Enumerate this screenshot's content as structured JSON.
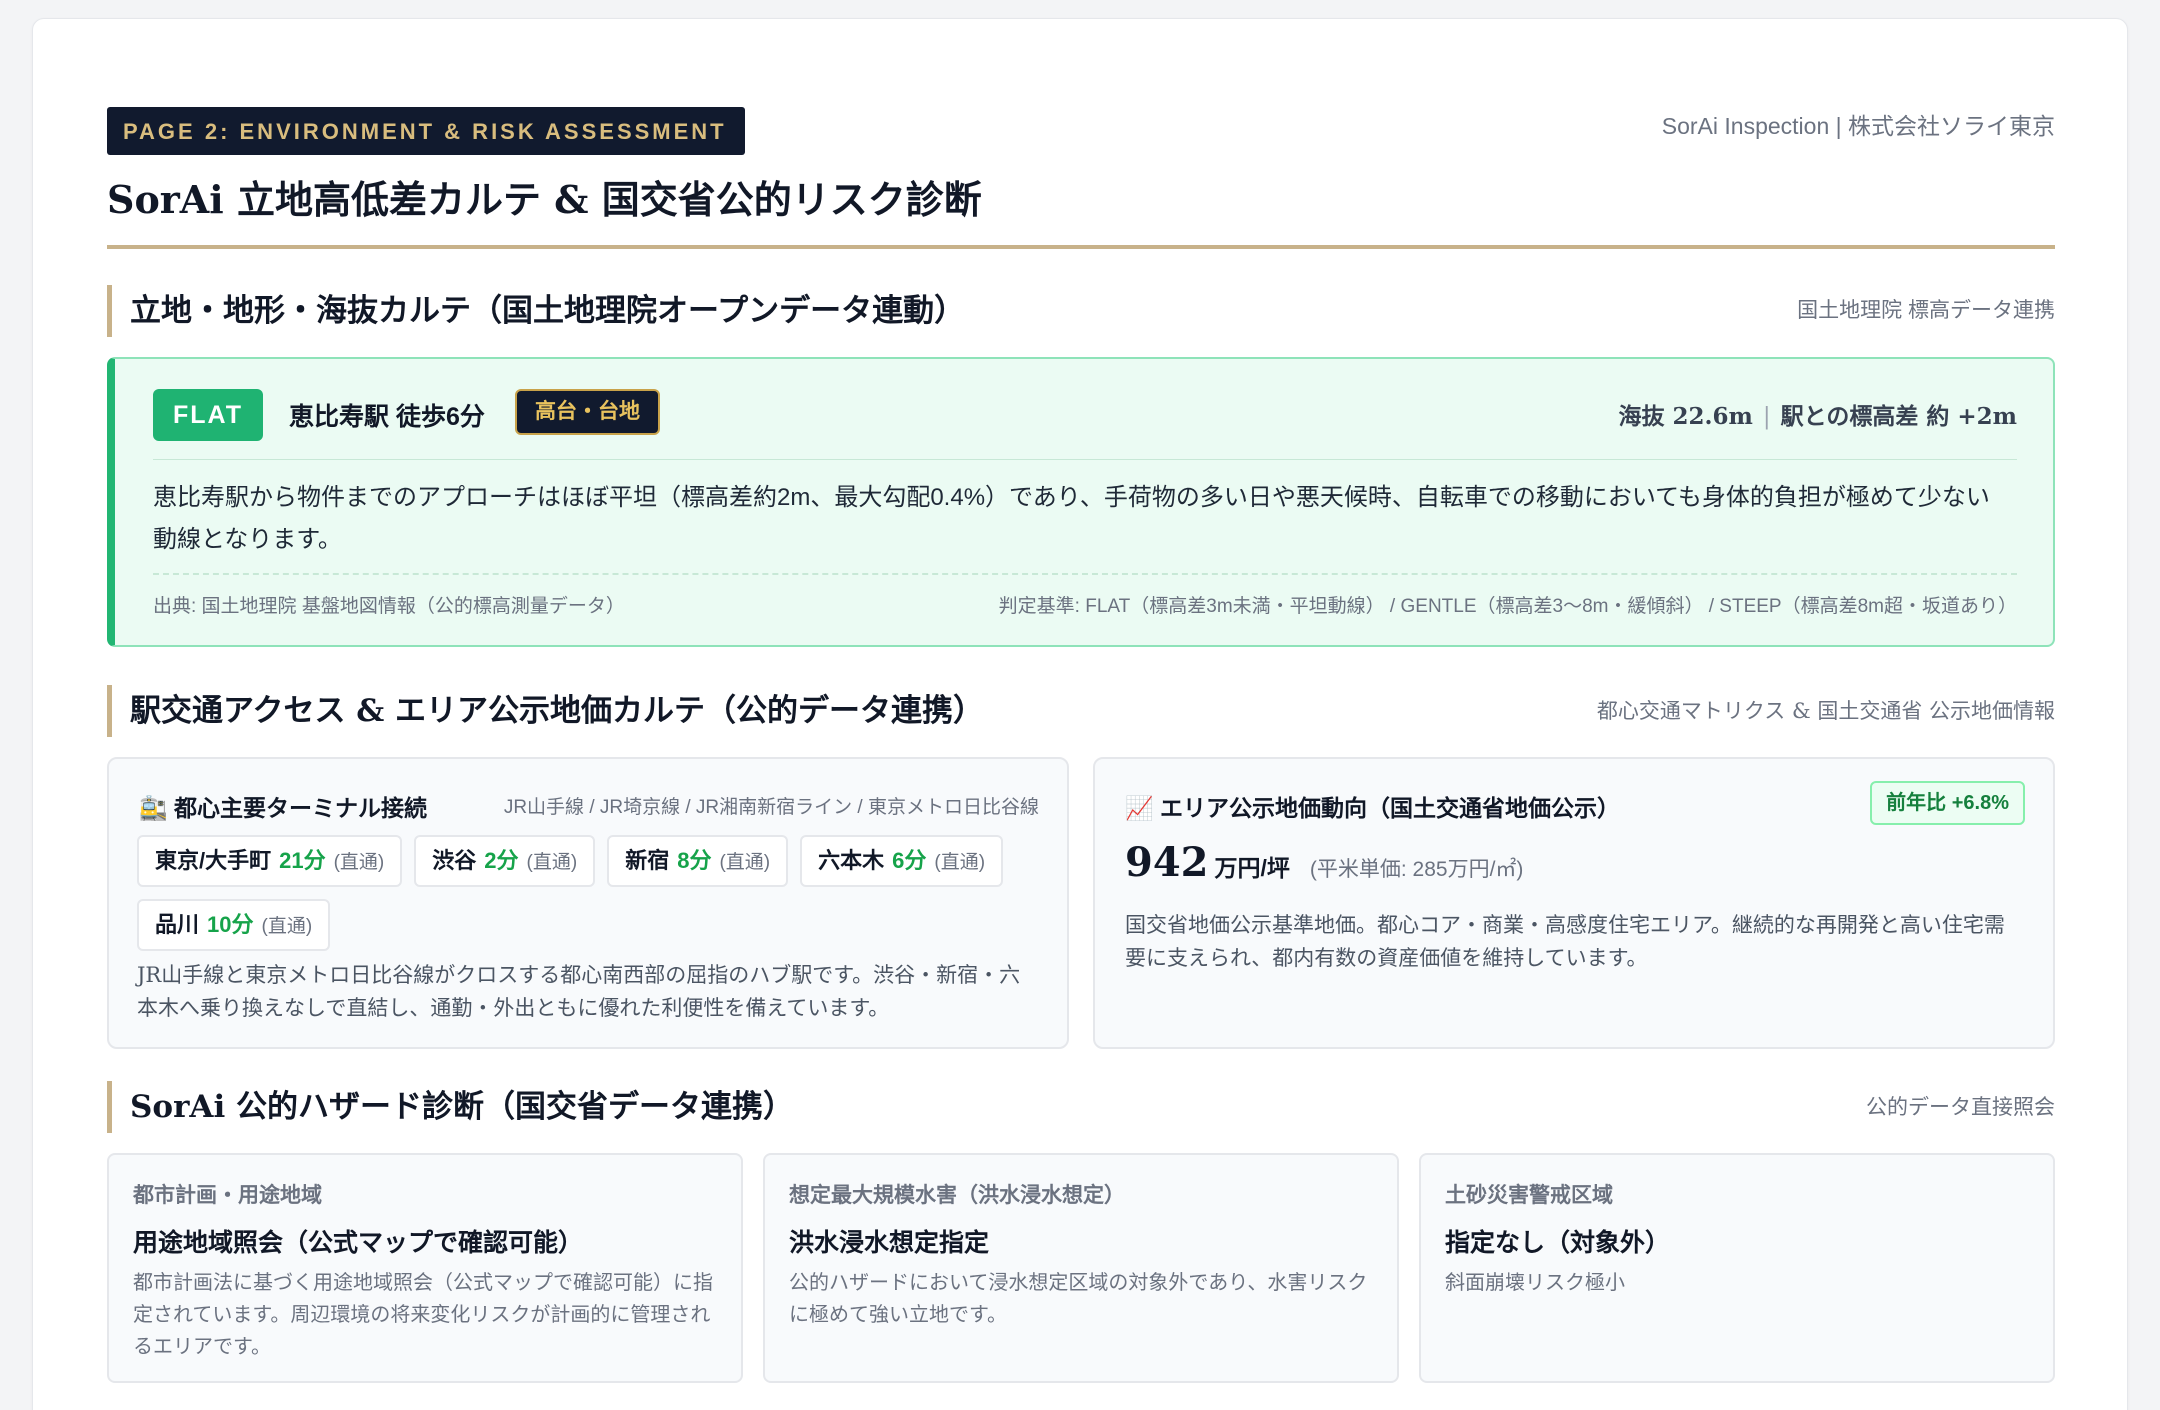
{
  "header": {
    "page_badge": "PAGE 2: ENVIRONMENT & RISK ASSESSMENT",
    "company": "SorAi Inspection | 株式会社ソライ東京",
    "title": "SorAi 立地高低差カルテ & 国交省公的リスク診断"
  },
  "terrain_section": {
    "title": "立地・地形・海抜カルテ（国土地理院オープンデータ連動）",
    "note": "国土地理院 標高データ連携",
    "badge": "FLAT",
    "station": "恵比寿駅 徒歩6分",
    "area_tag": "高台・台地",
    "elevation": "海抜 22.6m",
    "station_diff": "駅との標高差 約 +2m",
    "description": "恵比寿駅から物件までのアプローチはほぼ平坦（標高差約2m、最大勾配0.4%）であり、手荷物の多い日や悪天候時、自転車での移動においても身体的負担が極めて少ない動線となります。",
    "source": "出典: 国土地理院 基盤地図情報（公的標高測量データ）",
    "criteria": "判定基準: FLAT（標高差3m未満・平坦動線） / GENTLE（標高差3〜8m・緩傾斜） / STEEP（標高差8m超・坂道あり）"
  },
  "access_section": {
    "title": "駅交通アクセス & エリア公示地価カルテ（公的データ連携）",
    "note": "都心交通マトリクス & 国土交通省 公示地価情報",
    "transit": {
      "icon": "train-icon",
      "title": "都心主要ターミナル接続",
      "lines": "JR山手線 / JR埼京線 / JR湘南新宿ライン / 東京メトロ日比谷線",
      "destinations": [
        {
          "name": "東京/大手町",
          "minutes": "21分",
          "note": "(直通)"
        },
        {
          "name": "渋谷",
          "minutes": "2分",
          "note": "(直通)"
        },
        {
          "name": "新宿",
          "minutes": "8分",
          "note": "(直通)"
        },
        {
          "name": "六本木",
          "minutes": "6分",
          "note": "(直通)"
        },
        {
          "name": "品川",
          "minutes": "10分",
          "note": "(直通)"
        }
      ],
      "description": "JR山手線と東京メトロ日比谷線がクロスする都心南西部の屈指のハブ駅です。渋谷・新宿・六本木へ乗り換えなしで直結し、通勤・外出ともに優れた利便性を備えています。"
    },
    "land_price": {
      "icon": "chart-up-icon",
      "title": "エリア公示地価動向（国土交通省地価公示）",
      "yoy": "前年比 +6.8%",
      "value": "942",
      "unit": "万円/坪",
      "per_sqm": "(平米単価: 285万円/㎡)",
      "description": "国交省地価公示基準地価。都心コア・商業・高感度住宅エリア。継続的な再開発と高い住宅需要に支えられ、都内有数の資産価値を維持しています。"
    }
  },
  "hazard_section": {
    "title": "SorAi 公的ハザード診断（国交省データ連携）",
    "note": "公的データ直接照会",
    "cards": [
      {
        "label": "都市計画・用途地域",
        "value": "用途地域照会（公式マップで確認可能）",
        "description": "都市計画法に基づく用途地域照会（公式マップで確認可能）に指定されています。周辺環境の将来変化リスクが計画的に管理されるエリアです。"
      },
      {
        "label": "想定最大規模水害（洪水浸水想定）",
        "value": "洪水浸水想定指定",
        "description": "公的ハザードにおいて浸水想定区域の対象外であり、水害リスクに極めて強い立地です。"
      },
      {
        "label": "土砂災害警戒区域",
        "value": "指定なし（対象外）",
        "description": "斜面崩壊リスク極小"
      }
    ]
  },
  "colors": {
    "navy": "#111a2e",
    "gold": "#c8b28a",
    "green": "#1fb372"
  }
}
